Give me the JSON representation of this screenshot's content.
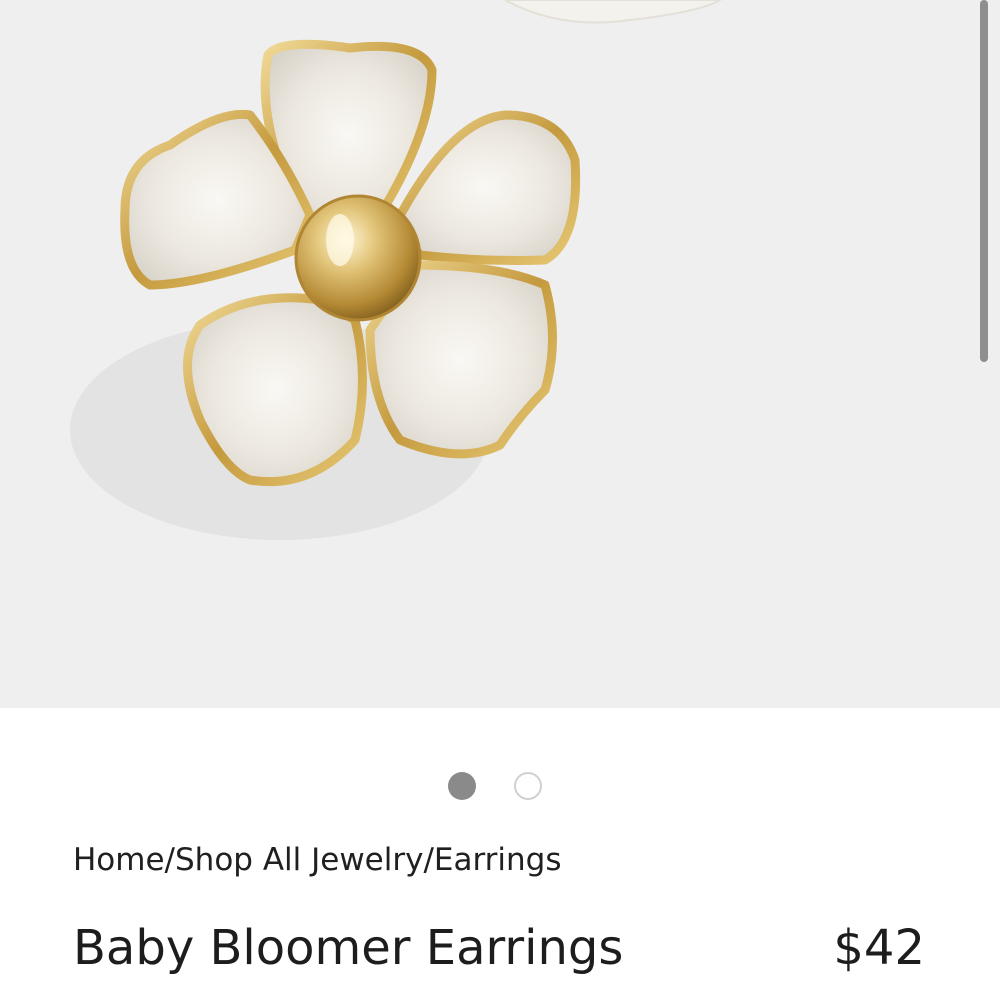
{
  "product": {
    "breadcrumb": "Home/Shop All Jewelry/Earrings",
    "title": "Baby Bloomer Earrings",
    "price": "$42"
  },
  "carousel": {
    "active_index": 0,
    "total": 2
  },
  "colors": {
    "image_background": "#efefef",
    "gold": "#c9a24a",
    "petal": "#f3f0ea",
    "dot_active": "#8a8a8a",
    "dot_inactive_border": "#d0d0d0"
  },
  "icons": {
    "carousel_dot_active": "filled-circle",
    "carousel_dot_inactive": "outlined-circle"
  }
}
